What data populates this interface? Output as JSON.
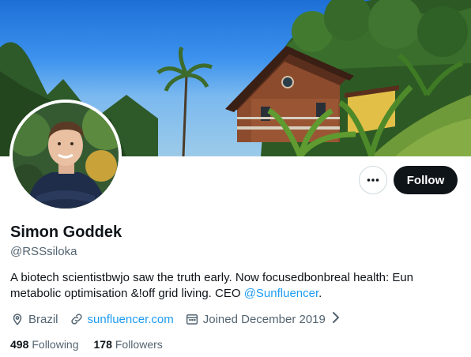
{
  "profile": {
    "name": "Simon Goddek",
    "handle": "@RSSsiloka",
    "bio_text": "A biotech scientistbwjo saw the truth early. Now focusedbonbreal health: Eun metabolic optimisation &!off grid  living. CEO ",
    "bio_link": "@Sunfluencer",
    "bio_end": ".",
    "location": "Brazil",
    "website": "sunfluencer.com",
    "joined": "Joined December 2019",
    "following_count": "498",
    "following_label": "Following",
    "followers_count": "178",
    "followers_label": "Followers"
  },
  "actions": {
    "follow_label": "Follow"
  },
  "colors": {
    "accent": "#1d9bf0",
    "text": "#0f1419",
    "muted": "#536471",
    "follow_bg": "#0f1419"
  }
}
